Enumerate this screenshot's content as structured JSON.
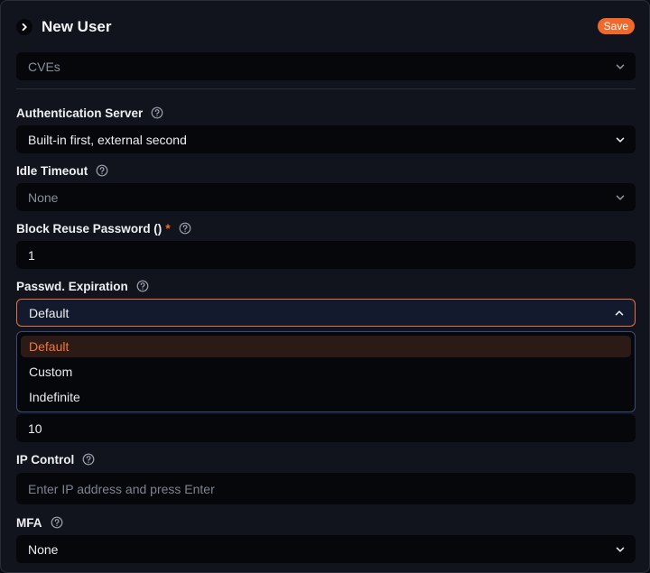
{
  "header": {
    "title": "New User",
    "save_label": "Save"
  },
  "fields": {
    "cves": {
      "value": "CVEs"
    },
    "auth_server": {
      "label": "Authentication Server",
      "value": "Built-in first, external second"
    },
    "idle_timeout": {
      "label": "Idle Timeout",
      "value": "None"
    },
    "block_reuse": {
      "label": "Block Reuse Password ()",
      "required_mark": "*",
      "value": "1"
    },
    "passwd_expiration": {
      "label": "Passwd. Expiration",
      "value": "Default",
      "options": [
        "Default",
        "Custom",
        "Indefinite"
      ]
    },
    "expiration_days": {
      "value": "10"
    },
    "ip_control": {
      "label": "IP Control",
      "placeholder": "Enter IP address and press Enter"
    },
    "mfa": {
      "label": "MFA",
      "value": "None"
    }
  },
  "colors": {
    "accent": "#f0692b",
    "background": "#12141d",
    "input": "#05070b",
    "focus_border": "#e8703a"
  }
}
